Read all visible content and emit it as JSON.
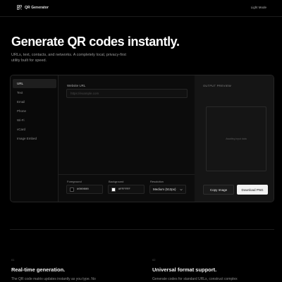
{
  "app": {
    "name": "QR Generator",
    "mode_toggle": "Light Mode"
  },
  "hero": {
    "title": "Generate QR codes instantly.",
    "subtitle": "URLs, text, contacts, and networks. A completely local, privacy-first utility built for speed."
  },
  "sidebar": {
    "items": [
      {
        "label": "URL",
        "active": true
      },
      {
        "label": "Text",
        "active": false
      },
      {
        "label": "Email",
        "active": false
      },
      {
        "label": "Phone",
        "active": false
      },
      {
        "label": "Wi-Fi",
        "active": false
      },
      {
        "label": "vCard",
        "active": false
      },
      {
        "label": "Image Embed",
        "active": false
      }
    ]
  },
  "form": {
    "url_label": "Website URL",
    "url_value": "",
    "url_placeholder": "https://example.com",
    "foreground_label": "Foreground",
    "foreground_value": "#000000",
    "background_label": "Background",
    "background_value": "#FFFFFF",
    "resolution_label": "Resolution",
    "resolution_value": "Medium (512px)"
  },
  "preview": {
    "label": "OUTPUT PREVIEW",
    "status": "Awaiting input data",
    "copy_label": "Copy Image",
    "download_label": "Download PNG"
  },
  "features": [
    {
      "number": "01",
      "title": "Real-time generation.",
      "text": "The QR code matrix updates instantly as you type. No"
    },
    {
      "number": "02",
      "title": "Universal format support.",
      "text": "Generate codes for standard URLs, construct complex"
    }
  ],
  "colors": {
    "background": "#000000",
    "panel": "#0c0c0c",
    "preview_panel": "#151515",
    "primary_button": "#f2f2f2",
    "foreground_swatch": "#000000",
    "background_swatch": "#FFFFFF"
  },
  "icons": {
    "brand": "qr-code-icon",
    "select": "chevron-down-icon"
  }
}
